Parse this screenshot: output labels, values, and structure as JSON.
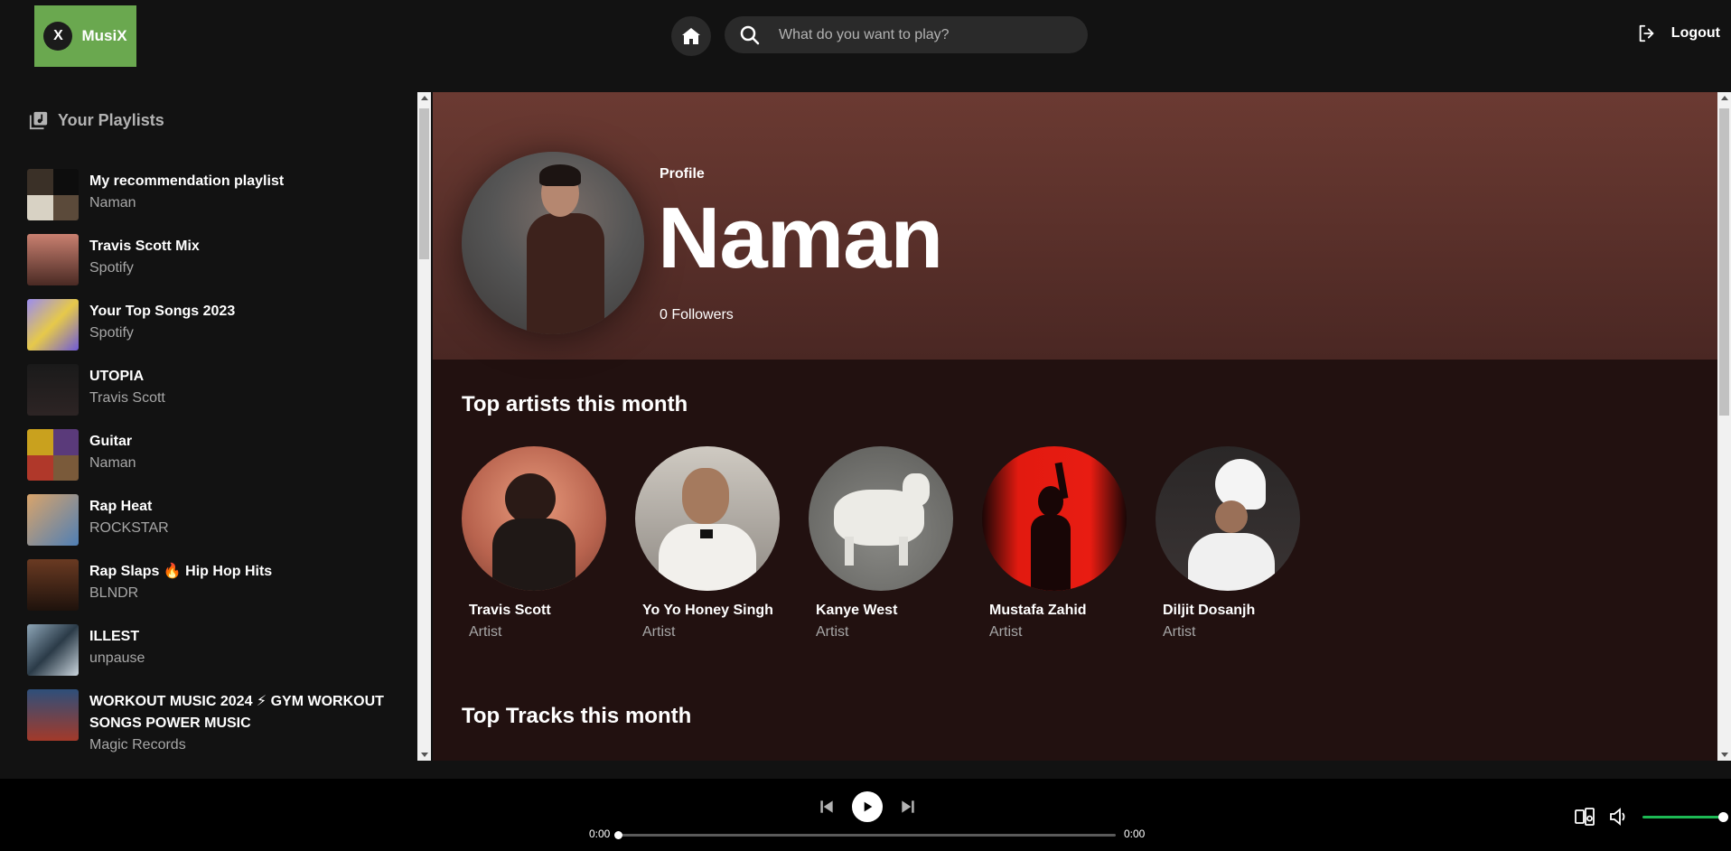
{
  "app": {
    "logo_letter": "X",
    "logo_name": "MusiX"
  },
  "search": {
    "placeholder": "What do you want to play?"
  },
  "header": {
    "logout_label": "Logout"
  },
  "sidebar": {
    "title": "Your Playlists",
    "playlists": [
      {
        "name": "My recommendation playlist",
        "owner": "Naman"
      },
      {
        "name": "Travis Scott Mix",
        "owner": "Spotify"
      },
      {
        "name": "Your Top Songs 2023",
        "owner": "Spotify"
      },
      {
        "name": "UTOPIA",
        "owner": "Travis Scott"
      },
      {
        "name": "Guitar",
        "owner": "Naman"
      },
      {
        "name": "Rap Heat",
        "owner": "ROCKSTAR"
      },
      {
        "name": "Rap Slaps 🔥 Hip Hop Hits",
        "owner": "BLNDR"
      },
      {
        "name": "ILLEST",
        "owner": "unpause"
      },
      {
        "name": "WORKOUT MUSIC 2024 ⚡ GYM WORKOUT SONGS POWER MUSIC",
        "owner": "Magic Records"
      }
    ]
  },
  "profile": {
    "label": "Profile",
    "name": "Naman",
    "followers": "0 Followers"
  },
  "sections": {
    "top_artists_title": "Top artists this month",
    "top_tracks_title": "Top Tracks this month"
  },
  "artists": [
    {
      "name": "Travis Scott",
      "role": "Artist"
    },
    {
      "name": "Yo Yo Honey Singh",
      "role": "Artist"
    },
    {
      "name": "Kanye West",
      "role": "Artist"
    },
    {
      "name": "Mustafa Zahid",
      "role": "Artist"
    },
    {
      "name": "Diljit Dosanjh",
      "role": "Artist"
    }
  ],
  "player": {
    "current_time": "0:00",
    "total_time": "0:00",
    "progress": 0,
    "volume": 1.0
  },
  "colors": {
    "accent": "#1db954",
    "logo_bg": "#6aa84f",
    "header_gradient_top": "#6b3a32"
  }
}
